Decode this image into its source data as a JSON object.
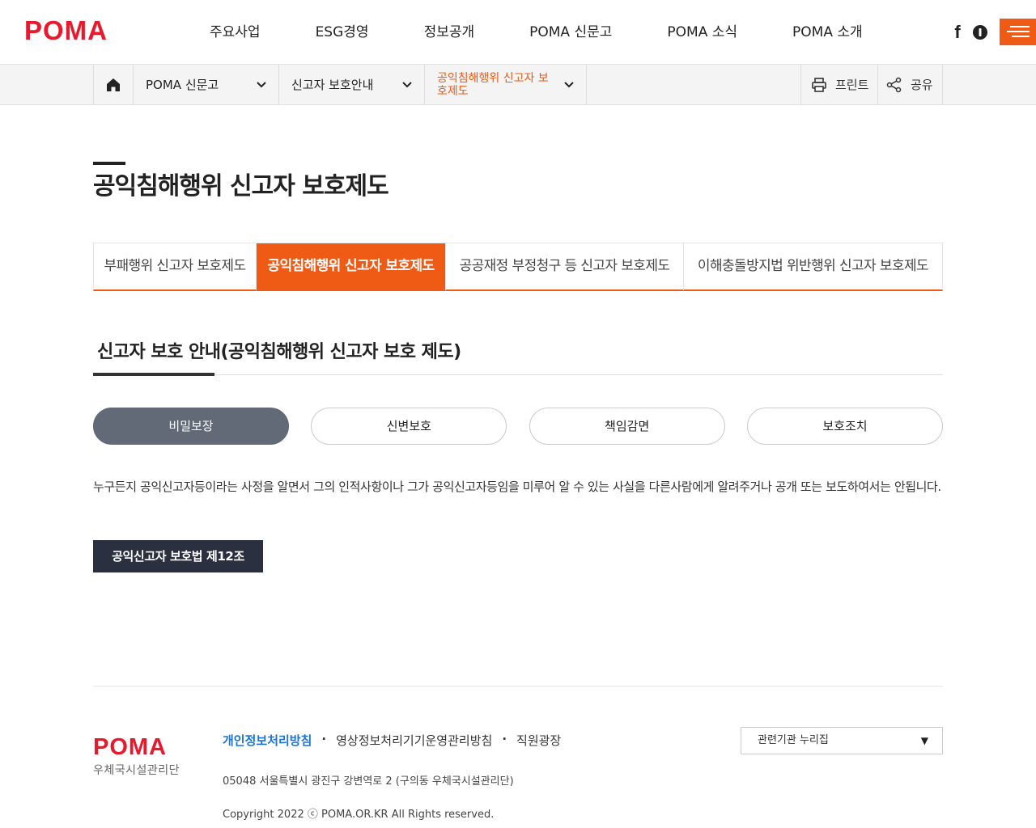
{
  "header": {
    "logo_text": "POMA",
    "nav": [
      "주요사업",
      "ESG경영",
      "정보공개",
      "POMA 신문고",
      "POMA 소식",
      "POMA 소개"
    ],
    "brand_color": "#ef5a14",
    "logo_color": "#e8192c"
  },
  "locbar": {
    "home_icon": "home-icon",
    "depth1": "POMA 신문고",
    "depth2": "신고자 보호안내",
    "depth3": "공익침해행위 신고자 보호제도",
    "print_label": "프린트",
    "share_label": "공유"
  },
  "page": {
    "title": "공익침해행위 신고자 보호제도",
    "tabs": [
      {
        "label": "부패행위 신고자 보호제도",
        "active": false
      },
      {
        "label": "공익침해행위 신고자 보호제도",
        "active": true
      },
      {
        "label": "공공재정 부정청구 등 신고자 보호제도",
        "active": false
      },
      {
        "label": "이해충돌방지법 위반행위 신고자 보호제도",
        "active": false
      }
    ],
    "section_title": "신고자 보호 안내(공익침해행위 신고자 보호 제도)",
    "pills": [
      {
        "label": "비밀보장",
        "active": true
      },
      {
        "label": "신변보호",
        "active": false
      },
      {
        "label": "책임감면",
        "active": false
      },
      {
        "label": "보호조치",
        "active": false
      }
    ],
    "description": "누구든지 공익신고자등이라는 사정을 알면서 그의 인적사항이나 그가 공익신고자등임을 미루어 알 수 있는 사실을 다른사람에게 알려주거나 공개 또는 보도하여서는 안됩니다.",
    "law_button": "공익신고자 보호법 제12조"
  },
  "footer": {
    "logo_text": "POMA",
    "logo_sub": "우체국시설관리단",
    "links": [
      "개인정보처리방침",
      "영상정보처리기기운영관리방침",
      "직원광장"
    ],
    "address": "05048 서울특별시 광진구 강변역로 2 (구의동 우체국시설관리단)",
    "copyright": "Copyright 2022 ⓒ POMA.OR.KR All Rights reserved.",
    "family_site": "관련기관 누리집"
  }
}
